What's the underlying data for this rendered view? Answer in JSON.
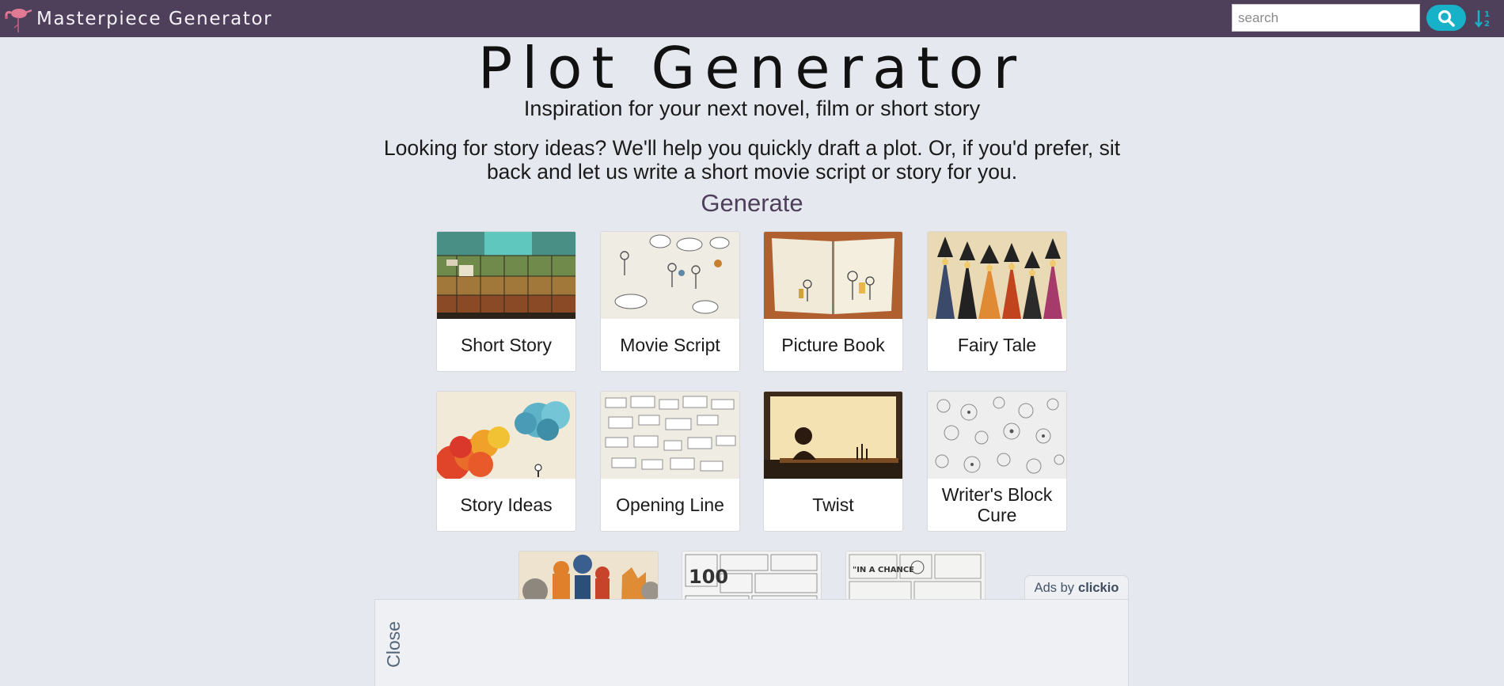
{
  "nav": {
    "brand": "Masterpiece Generator",
    "search_placeholder": "search",
    "accent_color": "#17b1c8",
    "bar_color": "#4e3f5a"
  },
  "hero": {
    "title": "Plot Generator",
    "subtitle": "Inspiration for your next novel, film or short story",
    "intro": "Looking for story ideas? We'll help you quickly draft a plot. Or, if you'd prefer, sit back and let us write a short movie script or story for you."
  },
  "generate": {
    "heading": "Generate",
    "cards": [
      {
        "label": "Short Story",
        "thumb": "library-shelves-thumbnail"
      },
      {
        "label": "Movie Script",
        "thumb": "speech-bubbles-sketch-thumbnail"
      },
      {
        "label": "Picture Book",
        "thumb": "open-book-thumbnail"
      },
      {
        "label": "Fairy Tale",
        "thumb": "witches-thumbnail"
      },
      {
        "label": "Story Ideas",
        "thumb": "colorful-clouds-thumbnail"
      },
      {
        "label": "Opening Line",
        "thumb": "notes-sketch-thumbnail"
      },
      {
        "label": "Twist",
        "thumb": "writer-at-desk-thumbnail"
      },
      {
        "label": "Writer's Block Cure",
        "thumb": "doodles-thumbnail"
      }
    ],
    "partial_cards": [
      {
        "thumb": "colorful-cats-thumbnail"
      },
      {
        "thumb": "comic-100-thumbnail"
      },
      {
        "thumb": "newspaper-comic-thumbnail"
      }
    ]
  },
  "ad": {
    "ads_by": "Ads by",
    "provider": "clickio",
    "close_label": "Close"
  }
}
